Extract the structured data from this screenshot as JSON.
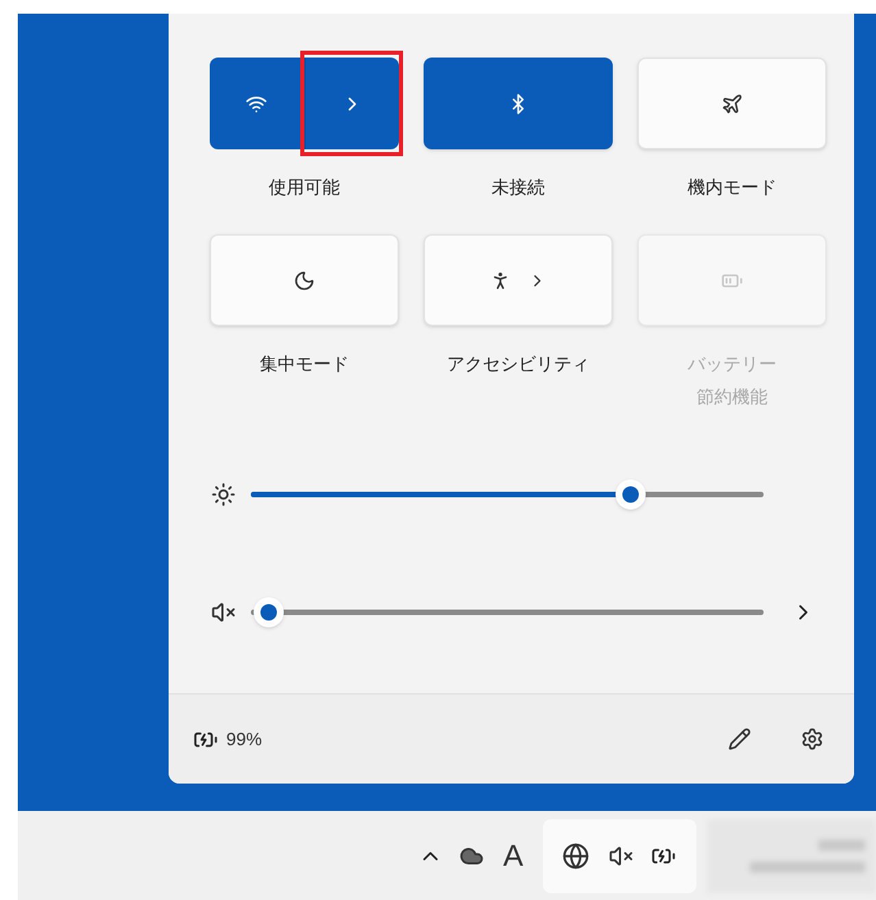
{
  "quick_settings": {
    "tiles": [
      {
        "kind": "split",
        "label": "使用可能",
        "on": true,
        "disabled": false,
        "highlighted": true
      },
      {
        "kind": "toggle",
        "label": "未接続",
        "on": true,
        "disabled": false
      },
      {
        "kind": "toggle",
        "label": "機内モード",
        "on": false,
        "disabled": false
      },
      {
        "kind": "toggle",
        "label": "集中モード",
        "on": false,
        "disabled": false
      },
      {
        "kind": "expandable",
        "label": "アクセシビリティ",
        "on": false,
        "disabled": false
      },
      {
        "kind": "toggle",
        "label_lines": [
          "バッテリー",
          "節約機能"
        ],
        "on": false,
        "disabled": true
      }
    ],
    "sliders": [
      {
        "kind": "brightness",
        "level": 0.74
      },
      {
        "kind": "volume",
        "muted": true,
        "has_menu": true
      }
    ],
    "footer": {
      "battery": "99%"
    }
  },
  "taskbar": {
    "input_indicator": "A"
  }
}
